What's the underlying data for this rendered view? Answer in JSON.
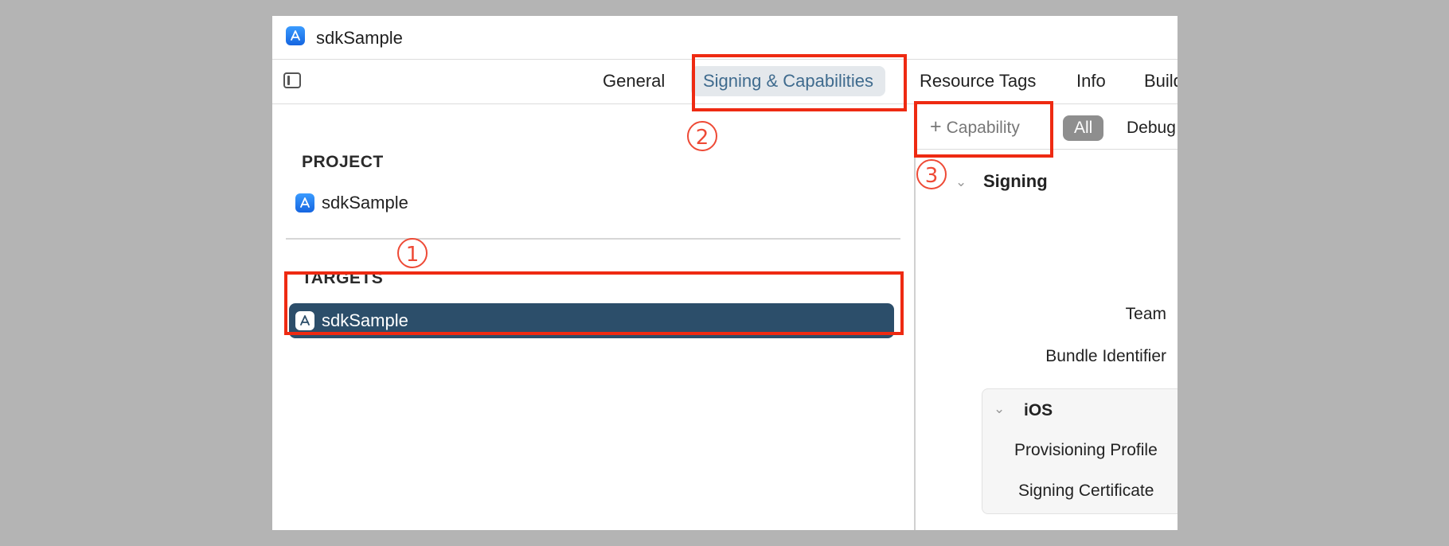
{
  "window": {
    "title": "sdkSample"
  },
  "tabs": [
    {
      "label": "General"
    },
    {
      "label": "Signing & Capabilities"
    },
    {
      "label": "Resource Tags"
    },
    {
      "label": "Info"
    },
    {
      "label": "Build"
    }
  ],
  "sidebar": {
    "project_header": "PROJECT",
    "project_item": "sdkSample",
    "targets_header": "TARGETS",
    "target_item": "sdkSample"
  },
  "main": {
    "capability_button": "Capability",
    "filter_all": "All",
    "filter_debug": "Debug",
    "signing_section": "Signing",
    "team_label": "Team",
    "bundle_label": "Bundle Identifier",
    "ios_section": "iOS",
    "provisioning_label": "Provisioning Profile",
    "certificate_label": "Signing Certificate"
  },
  "annotations": {
    "step1": "1",
    "step2": "2",
    "step3": "3"
  },
  "colors": {
    "highlight": "#ee2a12",
    "selected_row": "#2c4e6a",
    "active_tab_text": "#3f6b8e"
  },
  "icons": [
    "app-store-icon",
    "sidebar-toggle-icon",
    "plus-icon",
    "chevron-down-icon"
  ]
}
